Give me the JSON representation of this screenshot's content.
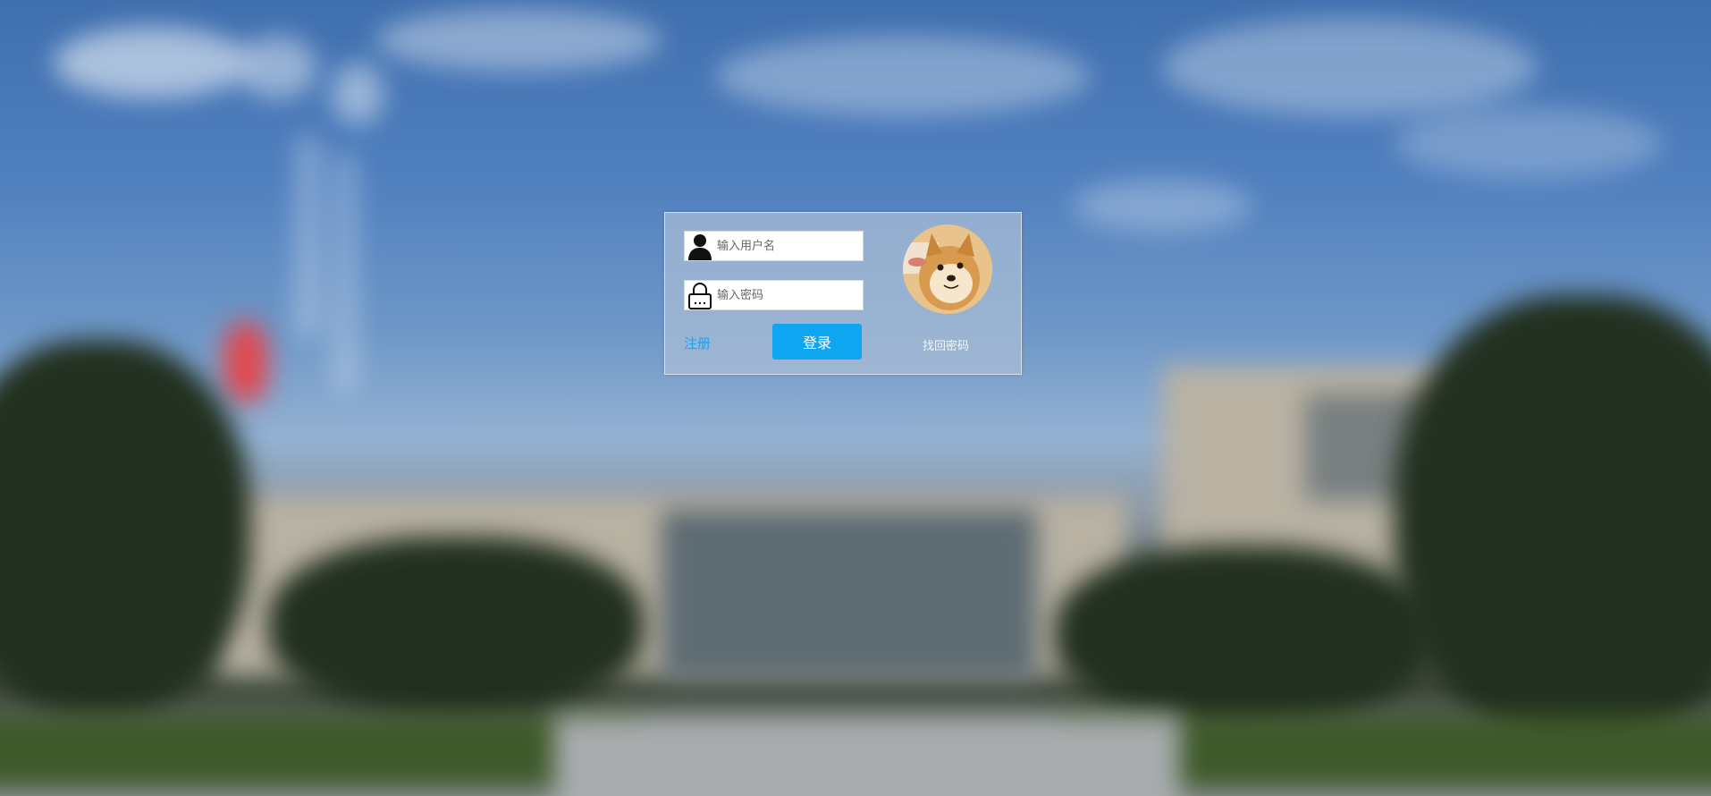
{
  "login": {
    "username_placeholder": "输入用户名",
    "password_placeholder": "输入密码",
    "register_label": "注册",
    "login_label": "登录",
    "forgot_label": "找回密码"
  },
  "icons": {
    "user": "user-icon",
    "lock": "lock-icon",
    "avatar": "shiba-avatar"
  },
  "colors": {
    "accent": "#0ea6f0",
    "link": "#1ea0f0"
  }
}
